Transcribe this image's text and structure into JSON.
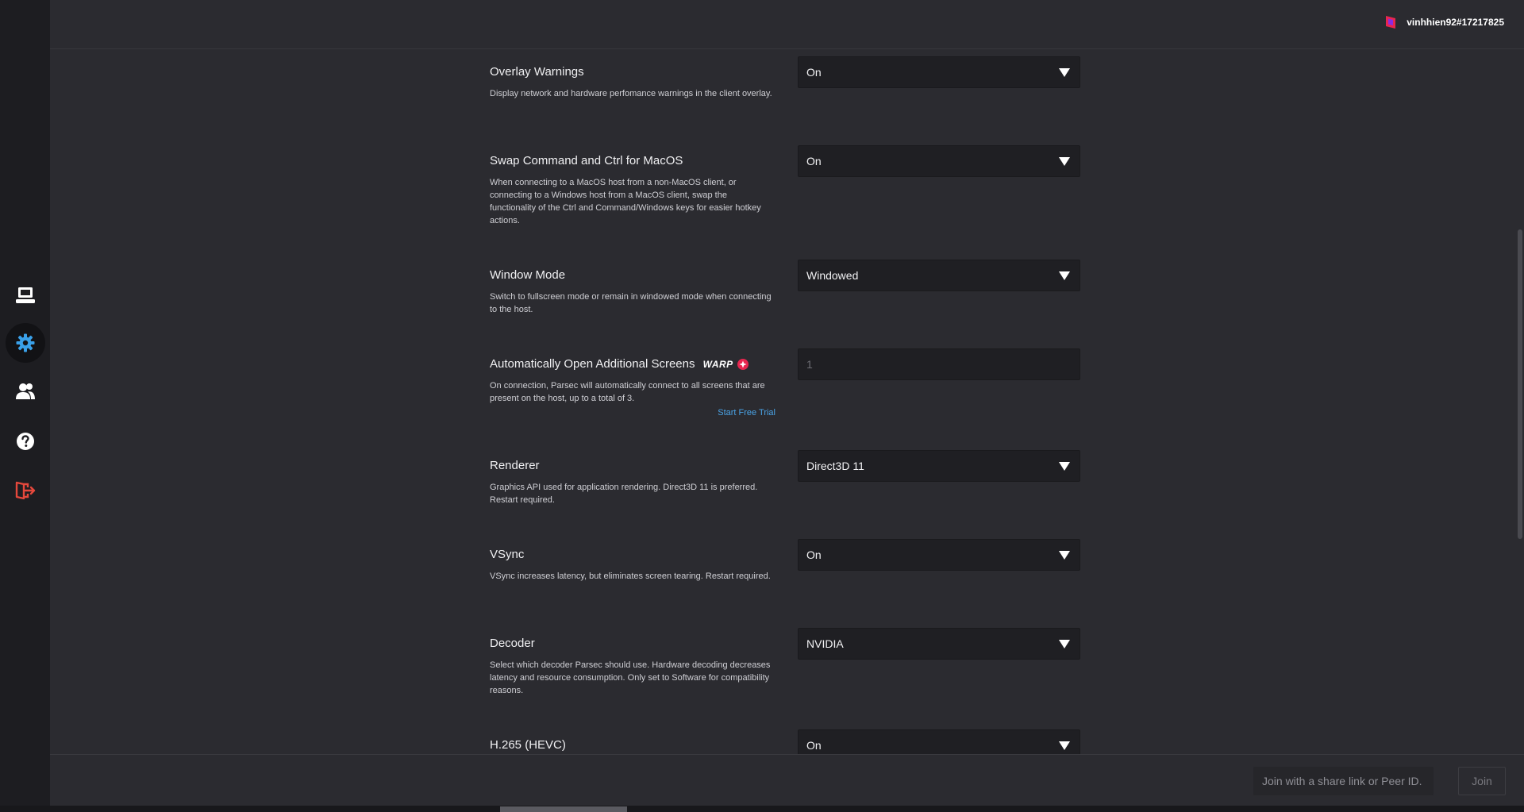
{
  "user": {
    "name": "vinhhien92#17217825"
  },
  "sidebar": {
    "items": [
      {
        "icon": "computer-icon",
        "active": false
      },
      {
        "icon": "gear-icon",
        "active": true
      },
      {
        "icon": "friends-icon",
        "active": false
      },
      {
        "icon": "help-icon",
        "active": false
      },
      {
        "icon": "logout-icon",
        "active": false
      }
    ]
  },
  "settings": [
    {
      "title": "Overlay Warnings",
      "description": "Display network and hardware perfomance warnings in the client overlay.",
      "value": "On"
    },
    {
      "title": "Swap Command and Ctrl for MacOS",
      "description": "When connecting to a MacOS host from a non-MacOS client, or connecting to a Windows host from a MacOS client, swap the functionality of the Ctrl and Command/Windows keys for easier hotkey actions.",
      "value": "On"
    },
    {
      "title": "Window Mode",
      "description": "Switch to fullscreen mode or remain in windowed mode when connecting to the host.",
      "value": "Windowed"
    },
    {
      "title": "Automatically Open Additional Screens",
      "badge": "WARP",
      "description": "On connection, Parsec will automatically connect to all screens that are present on the host, up to a total of 3.",
      "link": "Start Free Trial",
      "value": "1"
    },
    {
      "title": "Renderer",
      "description": "Graphics API used for application rendering. Direct3D 11 is preferred. Restart required.",
      "value": "Direct3D 11"
    },
    {
      "title": "VSync",
      "description": "VSync increases latency, but eliminates screen tearing. Restart required.",
      "value": "On"
    },
    {
      "title": "Decoder",
      "description": "Select which decoder Parsec should use. Hardware decoding decreases latency and resource consumption. Only set to Software for compatibility reasons.",
      "value": "NVIDIA"
    },
    {
      "title": "H.265 (HEVC)",
      "value": "On"
    }
  ],
  "bottom": {
    "join_placeholder": "Join with a share link or Peer ID.",
    "join_label": "Join"
  },
  "colors": {
    "accent": "#4aa3e6",
    "logout": "#e5483c",
    "warp": "#e8264f"
  }
}
